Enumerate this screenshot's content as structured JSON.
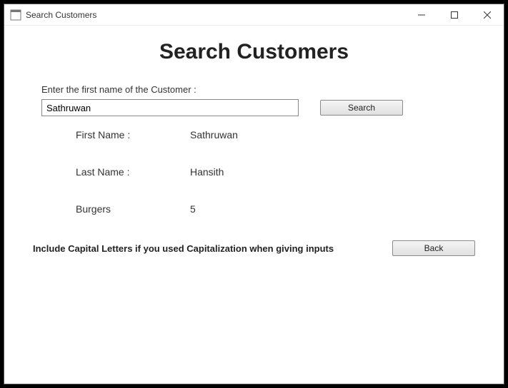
{
  "window": {
    "title": "Search Customers"
  },
  "heading": "Search Customers",
  "instruction": "Enter the first name of the Customer :",
  "search": {
    "value": "Sathruwan",
    "button_label": "Search"
  },
  "results": {
    "first_name_label": "First Name :",
    "first_name_value": "Sathruwan",
    "last_name_label": "Last Name :",
    "last_name_value": "Hansith",
    "burgers_label": "Burgers",
    "burgers_value": "5"
  },
  "footer": {
    "note": "Include Capital Letters if you used Capitalization when giving inputs",
    "back_label": "Back"
  }
}
